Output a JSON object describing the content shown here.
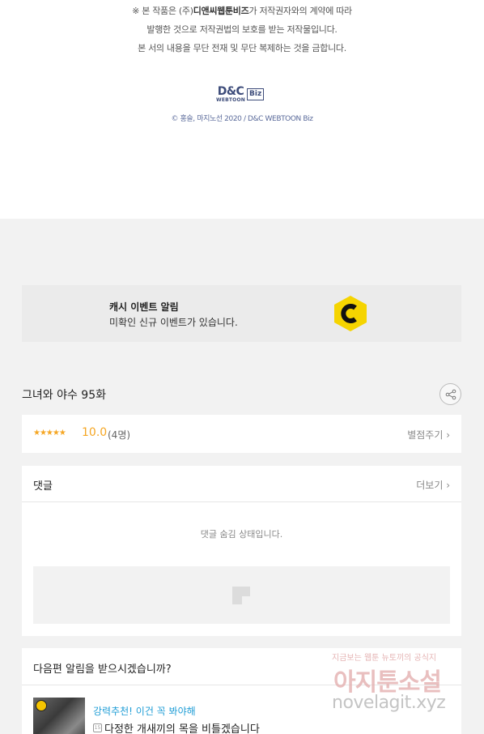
{
  "notice": {
    "line1_prefix": "※ 본 작품은 (주)",
    "line1_company": "디앤씨웹툰비즈",
    "line1_suffix": "가 저작권자와의 계약에 따라",
    "line2": "발행한 것으로 저작권법의 보호를 받는 저작물입니다.",
    "line3": "본 서의 내용을 무단 전재 및 무단 복제하는 것을 금합니다."
  },
  "logo": {
    "main": "D&C",
    "sub": "WEBTOON",
    "biz": "Biz"
  },
  "copyright": "© 홍슬, 마지노선 2020 / D&C WEBTOON Biz",
  "cash_event": {
    "title": "캐시 이벤트 알림",
    "subtitle": "미확인 신규 이벤트가 있습니다.",
    "icon": "cash-c-icon",
    "accent": "#f5d400"
  },
  "episode": {
    "title": "그녀와 야수 95화",
    "share_icon": "share-icon"
  },
  "rating": {
    "stars": "★★★★★",
    "score": "10.0",
    "count": "(4명)",
    "rate_link": "별점주기 ›",
    "star_color": "#f5a623"
  },
  "comments": {
    "title": "댓글",
    "more": "더보기 ›",
    "hidden_message": "댓글 숨김 상태입니다."
  },
  "next_episode": {
    "title": "다음편 알림을 받으시겠습니까?",
    "recommend_label": "강력추천! 이건 꼭 봐야해",
    "recommend_title": "다정한 개새끼의 목을 비틀겠습니다",
    "age_badge": "15",
    "label_color": "#1f9dd6"
  },
  "watermark": {
    "top": "지금보는 웹툰 뉴토끼의 공식지",
    "middle": "아지툰소설",
    "bottom": "novelagit.xyz"
  }
}
